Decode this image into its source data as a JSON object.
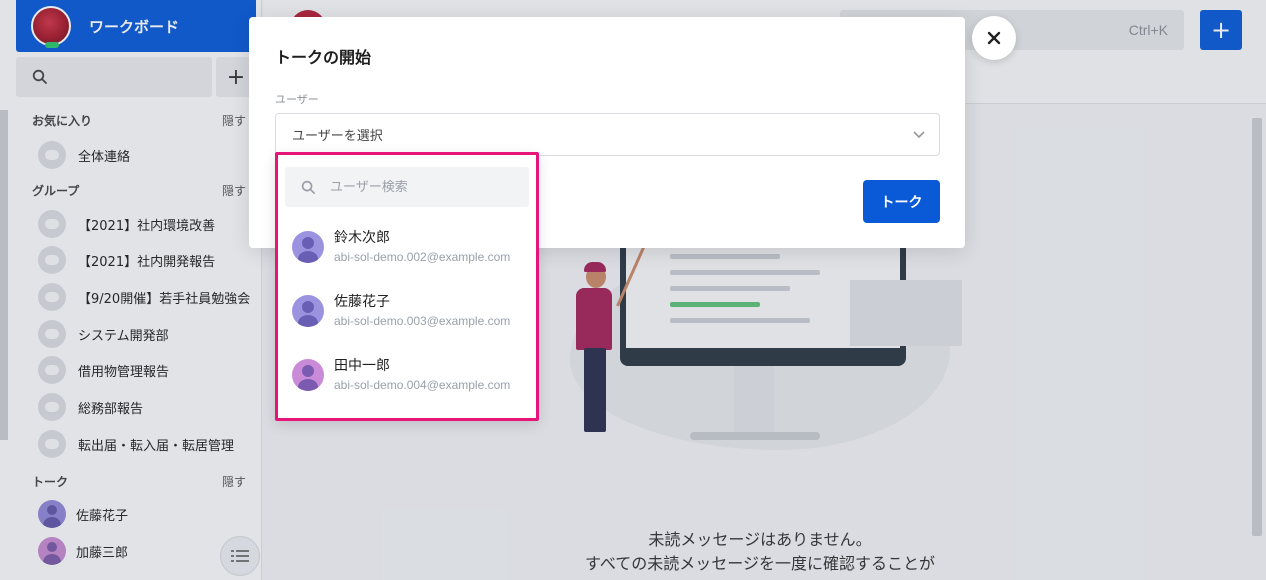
{
  "workspace": {
    "name": "ワークボード"
  },
  "sidebar": {
    "add_label": "+",
    "favorites": {
      "title": "お気に入り",
      "hide_label": "隠す",
      "items": [
        {
          "label": "全体連絡"
        }
      ]
    },
    "groups": {
      "title": "グループ",
      "hide_label": "隠す",
      "items": [
        {
          "label": "【2021】社内環境改善"
        },
        {
          "label": "【2021】社内開発報告"
        },
        {
          "label": "【9/20開催】若手社員勉強会"
        },
        {
          "label": "システム開発部"
        },
        {
          "label": "借用物管理報告"
        },
        {
          "label": "総務部報告"
        },
        {
          "label": "転出届・転入届・転居管理"
        }
      ]
    },
    "talks": {
      "title": "トーク",
      "hide_label": "隠す",
      "items": [
        {
          "label": "佐藤花子"
        },
        {
          "label": "加藤三郎"
        }
      ]
    }
  },
  "topbar": {
    "search_shortcut": "Ctrl+K",
    "add_label": "+"
  },
  "main": {
    "empty_line1": "未読メッセージはありません。",
    "empty_line2": "すべての未読メッセージを一度に確認することが"
  },
  "modal": {
    "title": "トークの開始",
    "user_label": "ユーザー",
    "user_placeholder": "ユーザーを選択",
    "talk_button": "トーク"
  },
  "dropdown": {
    "search_placeholder": "ユーザー検索",
    "highlight_color": "#e5157a",
    "users": [
      {
        "name": "鈴木次郎",
        "email": "abi-sol-demo.002@example.com"
      },
      {
        "name": "佐藤花子",
        "email": "abi-sol-demo.003@example.com"
      },
      {
        "name": "田中一郎",
        "email": "abi-sol-demo.004@example.com"
      }
    ]
  },
  "colors": {
    "brand_blue": "#0a5ad8",
    "highlight": "#e5157a"
  }
}
